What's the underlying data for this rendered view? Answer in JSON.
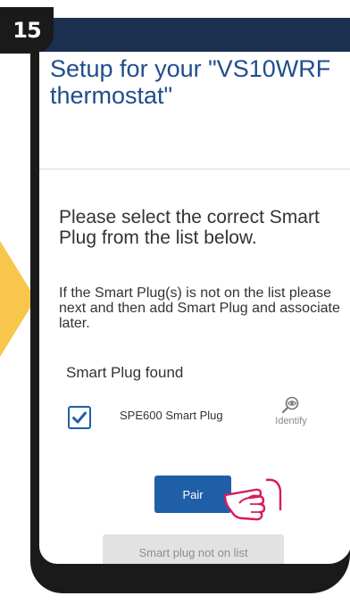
{
  "step": {
    "number": "15"
  },
  "header": {
    "title": "Setup for your \"VS10WRF thermostat\""
  },
  "content": {
    "heading": "Please select the correct Smart Plug from the list below.",
    "info": "If the Smart Plug(s) is not on the list please next and then add Smart Plug and associate later.",
    "found_label": "Smart Plug found",
    "devices": [
      {
        "name": "SPE600 Smart Plug",
        "checked": true,
        "identify_label": "Identify"
      }
    ]
  },
  "actions": {
    "pair_label": "Pair",
    "not_on_list_label": "Smart plug not on list"
  },
  "colors": {
    "accent": "#1f5fa8",
    "title": "#1f4e8c",
    "header_bar": "#1b2f4e",
    "callout_arrow": "#f8c64a"
  },
  "icons": {
    "checkbox": "checkmark-icon",
    "identify": "eye-icon",
    "pointer": "pointing-hand-icon"
  }
}
